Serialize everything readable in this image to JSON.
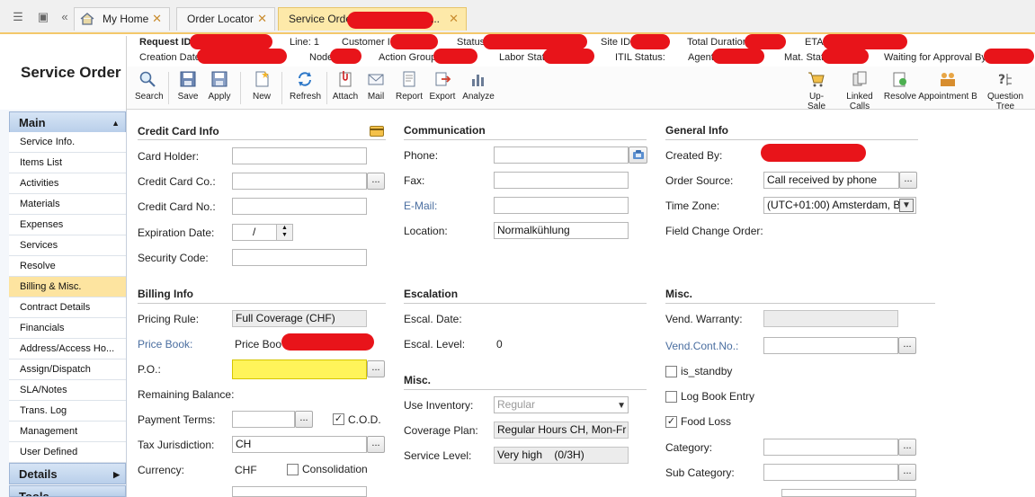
{
  "tabs": [
    {
      "label": "My Home"
    },
    {
      "label": "Order Locator"
    },
    {
      "label": "Service Order"
    }
  ],
  "app": {
    "title": "Service Order"
  },
  "info": {
    "request_id": "Request ID",
    "line": "Line: 1",
    "customer_id": "Customer ID",
    "status": "Status",
    "site_id": "Site ID",
    "total_duration": "Total Duration",
    "eta": "ETA",
    "creation_date": "Creation Date",
    "node": "Node",
    "action_group": "Action Group",
    "labor_stat": "Labor Stat",
    "itil_status": "ITIL Status:",
    "agent": "Agent",
    "mat_stat": "Mat. Stat",
    "waiting": "Waiting for Approval By"
  },
  "toolbar": {
    "search": "Search",
    "save": "Save",
    "apply": "Apply",
    "new": "New",
    "refresh": "Refresh",
    "attach": "Attach",
    "mail": "Mail",
    "report": "Report",
    "export": "Export",
    "analyze": "Analyze",
    "upsale": "Up-Sale",
    "linked_calls": "Linked Calls",
    "resolve": "Resolve",
    "appointment": "Appointment B",
    "question_tree": "Question Tree"
  },
  "sidebar": {
    "main": "Main",
    "items": [
      {
        "label": "Service Info."
      },
      {
        "label": "Items List"
      },
      {
        "label": "Activities"
      },
      {
        "label": "Materials"
      },
      {
        "label": "Expenses"
      },
      {
        "label": "Services"
      },
      {
        "label": "Resolve"
      },
      {
        "label": "Billing & Misc."
      },
      {
        "label": "Contract Details"
      },
      {
        "label": "Financials"
      },
      {
        "label": "Address/Access Ho..."
      },
      {
        "label": "Assign/Dispatch"
      },
      {
        "label": "SLA/Notes"
      },
      {
        "label": "Trans. Log"
      },
      {
        "label": "Management"
      },
      {
        "label": "User Defined"
      }
    ],
    "details": "Details",
    "tools": "Tools"
  },
  "credit_card": {
    "title": "Credit Card Info",
    "holder": "Card Holder:",
    "company": "Credit Card Co.:",
    "number": "Credit Card No.:",
    "expiration": "Expiration Date:",
    "expiration_value": "/",
    "security": "Security Code:"
  },
  "communication": {
    "title": "Communication",
    "phone": "Phone:",
    "fax": "Fax:",
    "email": "E-Mail:",
    "location": "Location:",
    "location_value": "Normalkühlung"
  },
  "general": {
    "title": "General Info",
    "created_by": "Created By:",
    "order_source": "Order Source:",
    "order_source_value": "Call received by phone",
    "time_zone": "Time Zone:",
    "time_zone_value": "(UTC+01:00) Amsterdam, B",
    "field_change": "Field Change Order:"
  },
  "billing": {
    "title": "Billing Info",
    "pricing_rule": "Pricing Rule:",
    "pricing_rule_value": "Full Coverage (CHF)",
    "price_book": "Price Book:",
    "price_book_value": "Price Boo",
    "po": "P.O.:",
    "remaining": "Remaining Balance:",
    "payment_terms": "Payment Terms:",
    "cod": "C.O.D.",
    "tax": "Tax Jurisdiction:",
    "tax_value": "CH",
    "currency": "Currency:",
    "currency_value": "CHF",
    "consolidation": "Consolidation"
  },
  "escalation": {
    "title": "Escalation",
    "date": "Escal. Date:",
    "level": "Escal. Level:",
    "level_value": "0"
  },
  "misc_mid": {
    "title": "Misc.",
    "use_inventory": "Use Inventory:",
    "use_inventory_value": "Regular",
    "coverage_plan": "Coverage Plan:",
    "coverage_plan_value": "Regular Hours CH, Mon-Fr",
    "service_level": "Service Level:",
    "service_level_value": "Very high    (0/3H)"
  },
  "misc_right": {
    "title": "Misc.",
    "vend_warranty": "Vend. Warranty:",
    "vend_cont_no": "Vend.Cont.No.:",
    "is_standby": "is_standby",
    "log_book": "Log Book Entry",
    "food_loss": "Food Loss",
    "category": "Category:",
    "sub_category": "Sub Category:"
  },
  "colors": {
    "accent": "#fde9a9",
    "highlight": "#fff45a",
    "redaction": "#e8141a"
  }
}
